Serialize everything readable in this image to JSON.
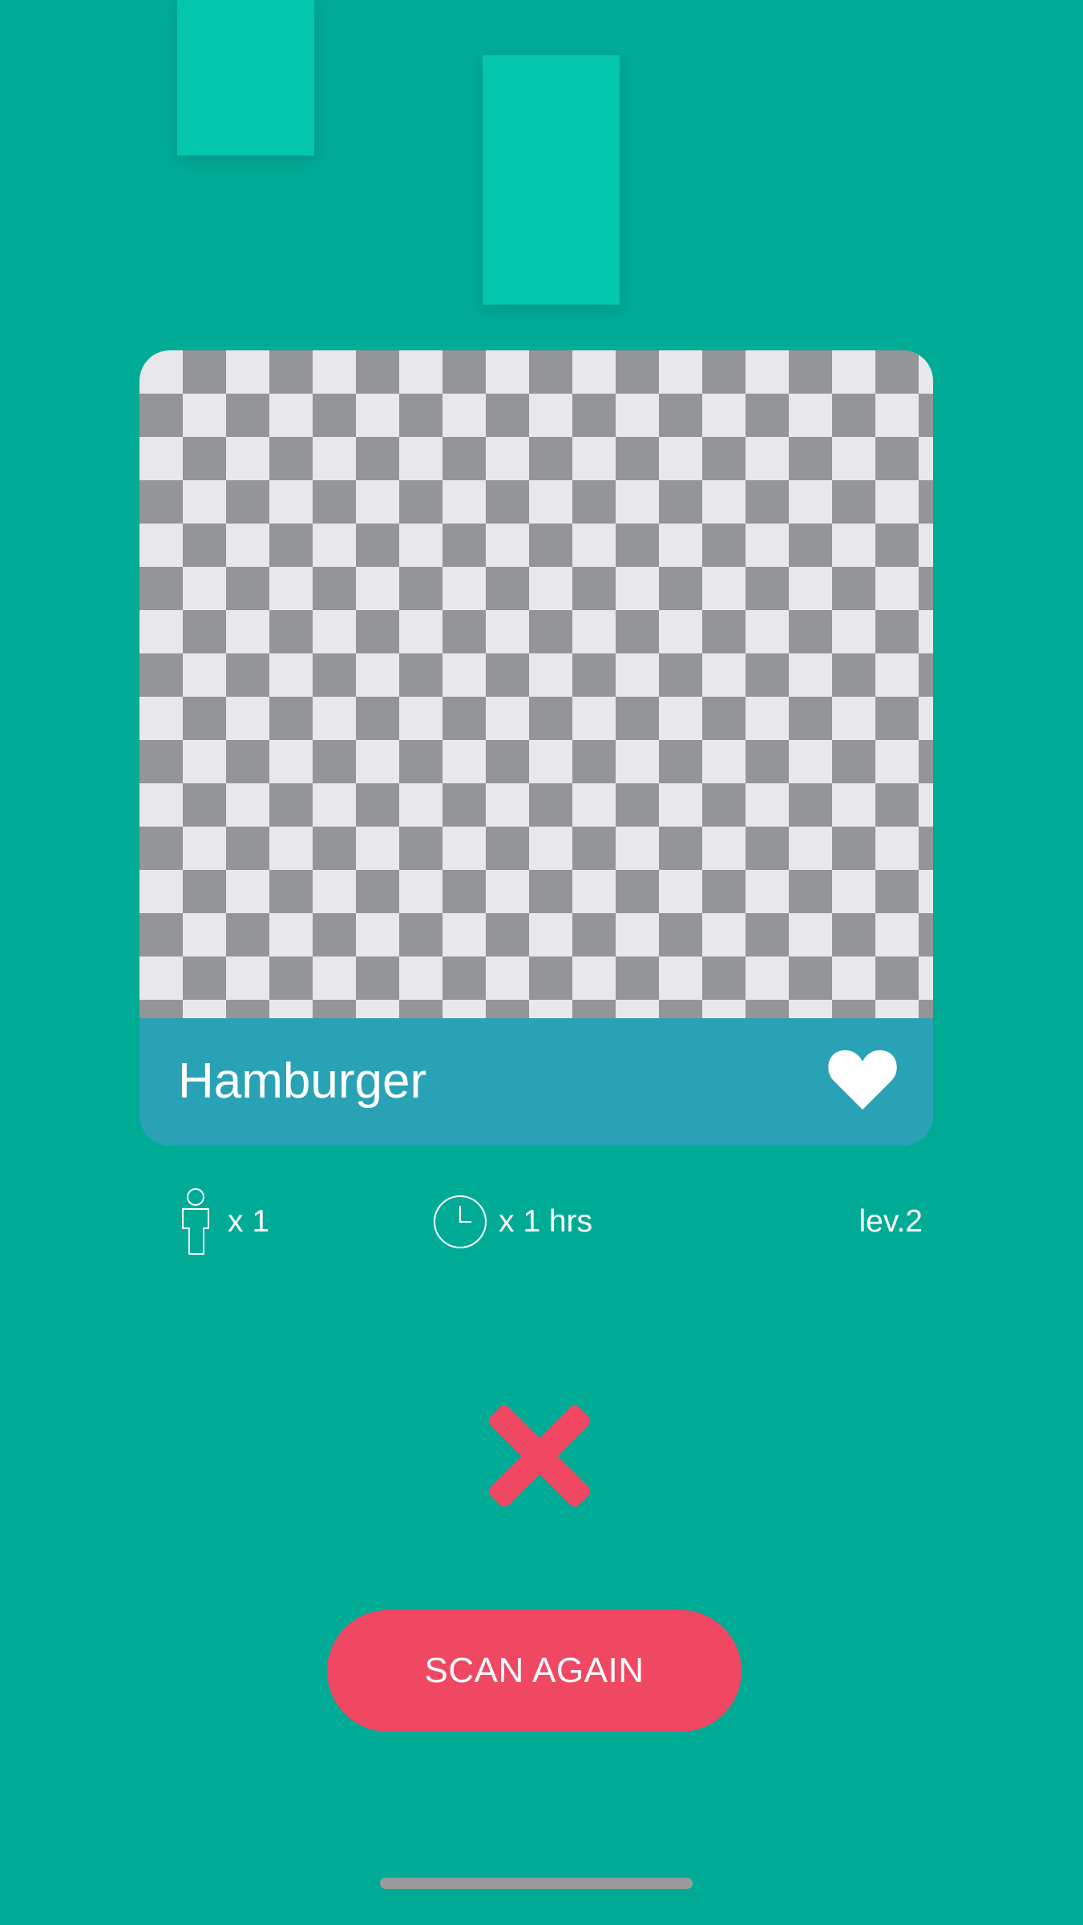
{
  "colors": {
    "background": "#00ab96",
    "decor_rect": "#03c6ad",
    "card_footer": "#2aa2b6",
    "checker_dark": "#939598",
    "checker_light": "#e8e8ea",
    "accent": "#f04763",
    "text": "#ffffff"
  },
  "card": {
    "image_placeholder": "transparent-checkerboard",
    "title": "Hamburger",
    "favorite_icon": "heart-icon"
  },
  "stats": {
    "people": {
      "icon": "person-icon",
      "text": "x 1"
    },
    "time": {
      "icon": "clock-icon",
      "text": "x 1 hrs"
    },
    "level": {
      "text": "lev.2"
    }
  },
  "result": {
    "icon": "close-icon"
  },
  "actions": {
    "scan_again_label": "SCAN AGAIN"
  }
}
